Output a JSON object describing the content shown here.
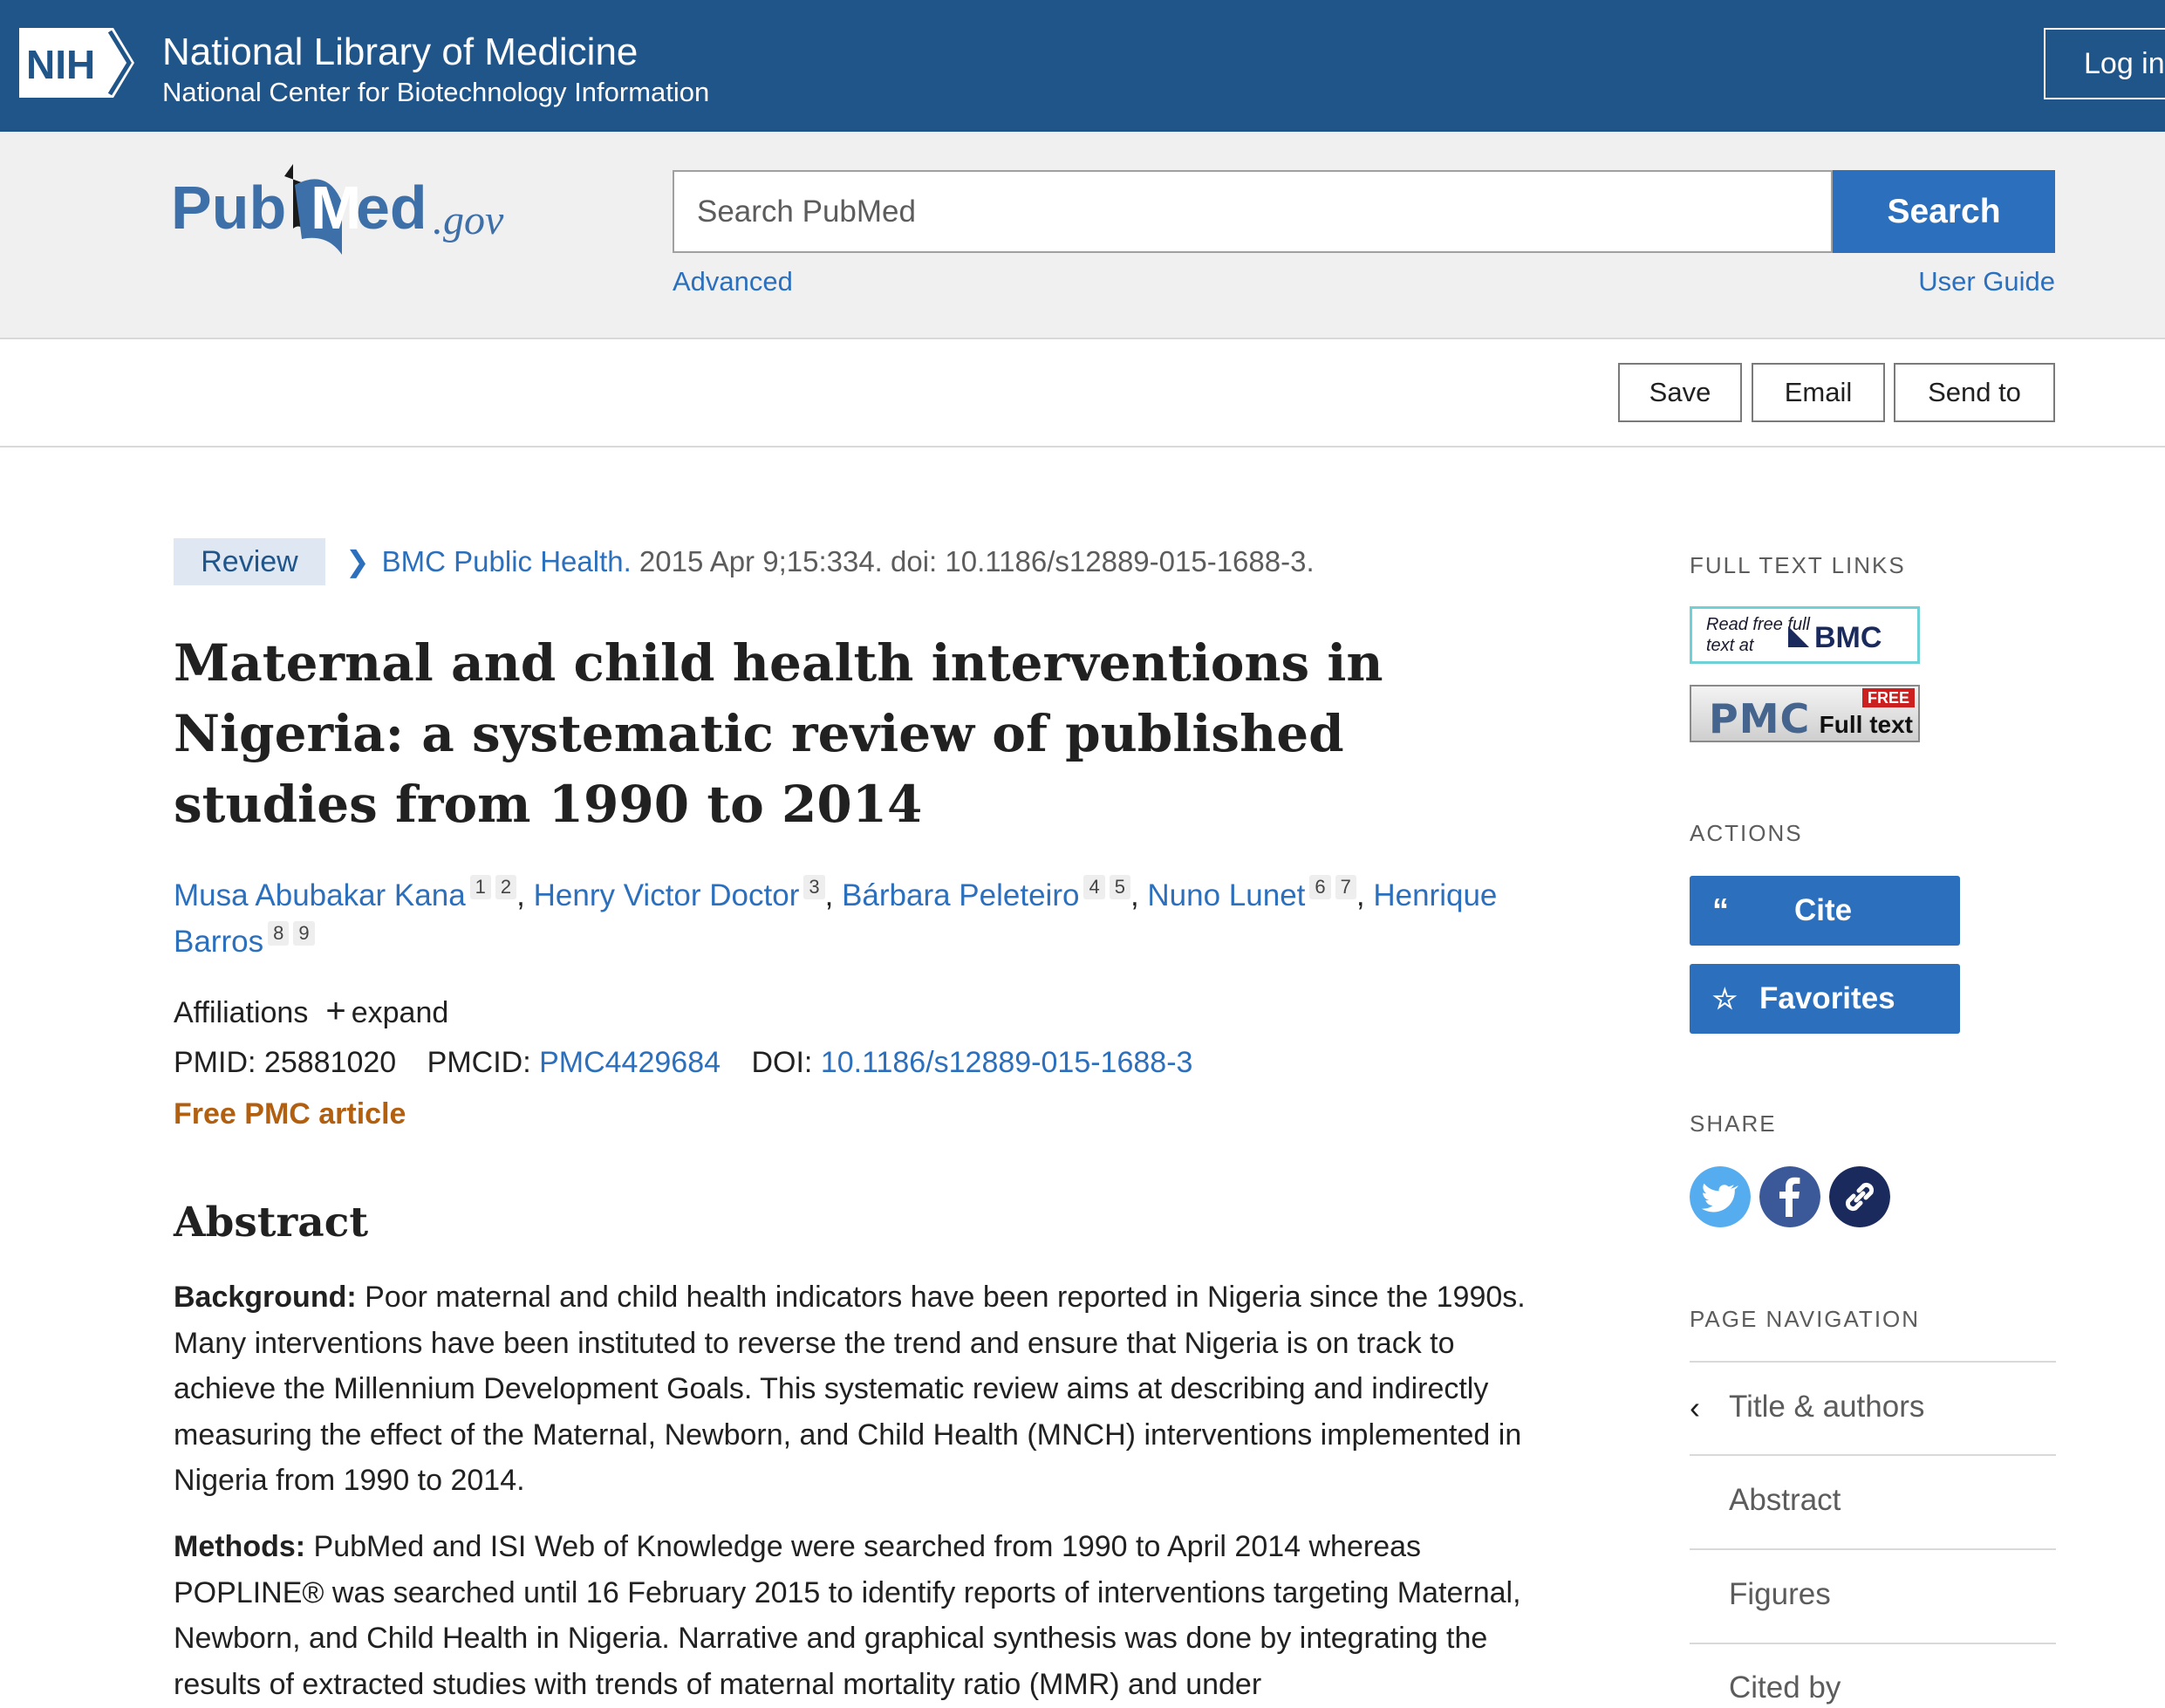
{
  "nih": {
    "logo_text": "NIH",
    "title": "National Library of Medicine",
    "subtitle": "National Center for Biotechnology Information",
    "login_label": "Log in"
  },
  "search": {
    "logo_text": "PubMed.gov",
    "placeholder": "Search PubMed",
    "button_label": "Search",
    "advanced_label": "Advanced",
    "user_guide_label": "User Guide"
  },
  "toolbar": {
    "save_label": "Save",
    "email_label": "Email",
    "send_to_label": "Send to"
  },
  "article": {
    "type_badge": "Review",
    "journal_name": "BMC Public Health.",
    "citation": " 2015 Apr 9;15:334. doi: 10.1186/s12889-015-1688-3.",
    "title": "Maternal and child health interventions in Nigeria: a systematic review of published studies from 1990 to 2014",
    "authors": [
      {
        "name": "Musa Abubakar Kana",
        "affils": [
          "1",
          "2"
        ]
      },
      {
        "name": "Henry Victor Doctor",
        "affils": [
          "3"
        ]
      },
      {
        "name": "Bárbara Peleteiro",
        "affils": [
          "4",
          "5"
        ]
      },
      {
        "name": "Nuno Lunet",
        "affils": [
          "6",
          "7"
        ]
      },
      {
        "name": "Henrique Barros",
        "affils": [
          "8",
          "9"
        ]
      }
    ],
    "author_separator": ", ",
    "affiliations_label": "Affiliations",
    "expand_label": "expand",
    "pmid_label": "PMID: ",
    "pmid": "25881020",
    "pmcid_label": "PMCID: ",
    "pmcid": "PMC4429684",
    "doi_label": "DOI: ",
    "doi": "10.1186/s12889-015-1688-3",
    "free_pmc_label": "Free PMC article",
    "abstract_heading": "Abstract",
    "abstract": [
      {
        "label": "Background:",
        "text": " Poor maternal and child health indicators have been reported in Nigeria since the 1990s. Many interventions have been instituted to reverse the trend and ensure that Nigeria is on track to achieve the Millennium Development Goals. This systematic review aims at describing and indirectly measuring the effect of the Maternal, Newborn, and Child Health (MNCH) interventions implemented in Nigeria from 1990 to 2014."
      },
      {
        "label": "Methods:",
        "text": " PubMed and ISI Web of Knowledge were searched from 1990 to April 2014 whereas POPLINE® was searched until 16 February 2015 to identify reports of interventions targeting Maternal, Newborn, and Child Health in Nigeria. Narrative and graphical synthesis was done by integrating the results of extracted studies with trends of maternal mortality ratio (MMR) and under"
      }
    ]
  },
  "sidebar": {
    "full_text_heading": "FULL TEXT LINKS",
    "bmc_small": "Read free full text at",
    "bmc_brand": "BMC",
    "pmc_brand": "PMC",
    "pmc_free": "FREE",
    "pmc_full": "Full text",
    "actions_heading": "ACTIONS",
    "cite_label": "Cite",
    "favorites_label": "Favorites",
    "share_heading": "SHARE",
    "page_nav_heading": "PAGE NAVIGATION",
    "nav_items": [
      "Title & authors",
      "Abstract",
      "Figures",
      "Cited by"
    ],
    "colors": {
      "twitter": "#55acee",
      "facebook": "#3b5998",
      "link": "#1a2a5c",
      "brand_blue": "#2b6fbd",
      "nih_blue": "#20558a"
    }
  }
}
